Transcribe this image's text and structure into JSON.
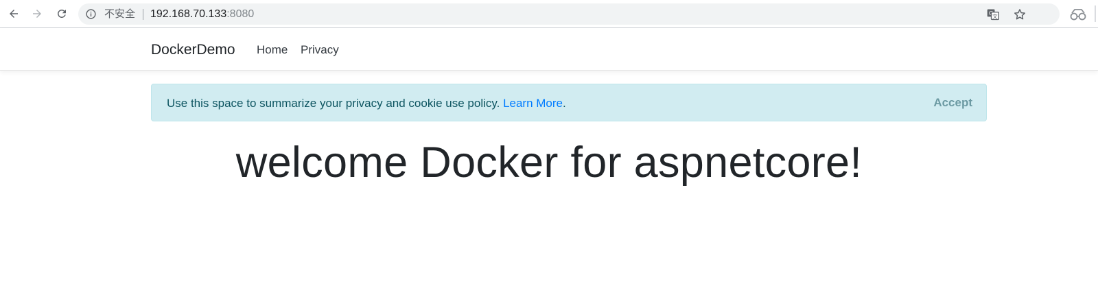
{
  "browser": {
    "back_icon": "arrow-left-icon",
    "forward_icon": "arrow-right-icon",
    "reload_icon": "reload-icon",
    "security_label": "不安全",
    "url_host": "192.168.70.133",
    "url_port": ":8080",
    "translate_icon": "translate-icon",
    "bookmark_icon": "star-icon",
    "extension_icon": "extension-icon"
  },
  "navbar": {
    "brand": "DockerDemo",
    "links": [
      {
        "label": "Home"
      },
      {
        "label": "Privacy"
      }
    ]
  },
  "cookie_consent": {
    "message": "Use this space to summarize your privacy and cookie use policy. ",
    "link_label": "Learn More",
    "after_link": ".",
    "accept_label": "Accept",
    "colors": {
      "background": "#d1ecf1",
      "text": "#0c5460",
      "link": "#007bff"
    }
  },
  "main": {
    "heading": "welcome Docker for aspnetcore!"
  }
}
